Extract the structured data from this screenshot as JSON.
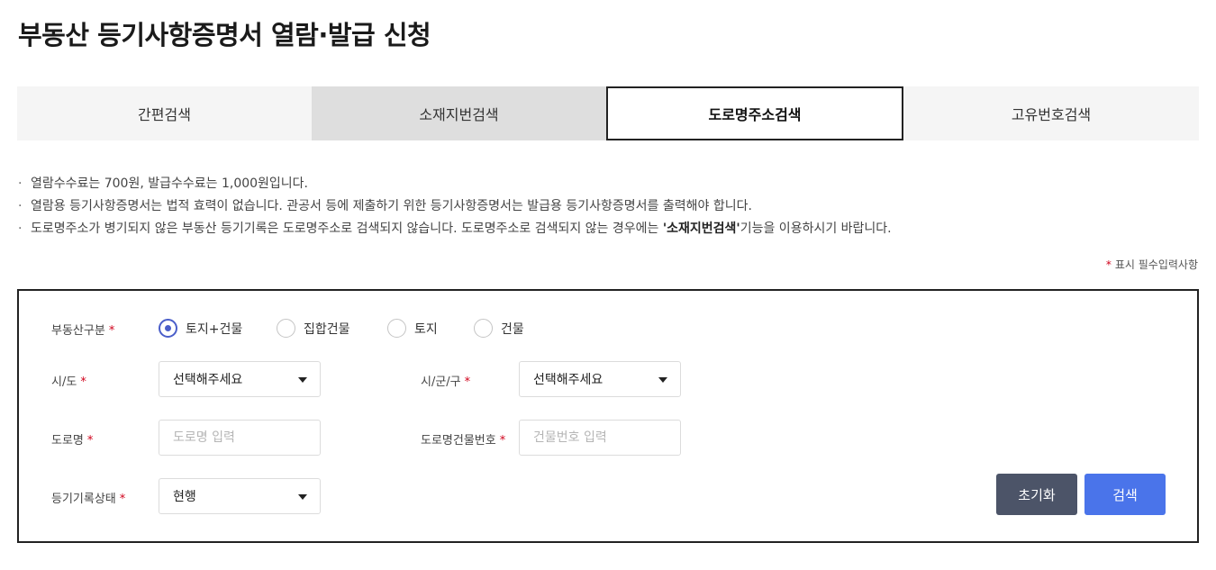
{
  "title": "부동산 등기사항증명서 열람·발급 신청",
  "tabs": [
    {
      "label": "간편검색"
    },
    {
      "label": "소재지번검색"
    },
    {
      "label": "도로명주소검색",
      "active": true
    },
    {
      "label": "고유번호검색"
    }
  ],
  "notices": {
    "line1": "열람수수료는  700원, 발급수수료는  1,000원입니다.",
    "line2": "열람용 등기사항증명서는 법적 효력이 없습니다. 관공서 등에 제출하기 위한 등기사항증명서는 발급용 등기사항증명서를 출력해야 합니다.",
    "line3_pre": "도로명주소가 병기되지 않은 부동산 등기기록은 도로명주소로 검색되지 않습니다. 도로명주소로 검색되지 않는 경우에는 ",
    "line3_bold": "'소재지번검색'",
    "line3_post": "기능을 이용하시기 바랍니다."
  },
  "required_note": {
    "star": "*",
    "text": "표시 필수입력사항"
  },
  "form": {
    "required_mark": "*",
    "property_type": {
      "label": "부동산구분",
      "options": [
        "토지+건물",
        "집합건물",
        "토지",
        "건물"
      ],
      "selected": "토지+건물"
    },
    "sido": {
      "label": "시/도",
      "value": "선택해주세요"
    },
    "sigungu": {
      "label": "시/군/구",
      "value": "선택해주세요"
    },
    "road_name": {
      "label": "도로명",
      "placeholder": "도로명 입력"
    },
    "building_no": {
      "label": "도로명건물번호",
      "placeholder": "건물번호 입력"
    },
    "record_status": {
      "label": "등기기록상태",
      "value": "현행"
    },
    "reset_label": "초기화",
    "search_label": "검색"
  },
  "colors": {
    "accent": "#4a5ec9",
    "search_button": "#4a74ea",
    "reset_button": "#4c5468",
    "required": "#d0021b"
  }
}
